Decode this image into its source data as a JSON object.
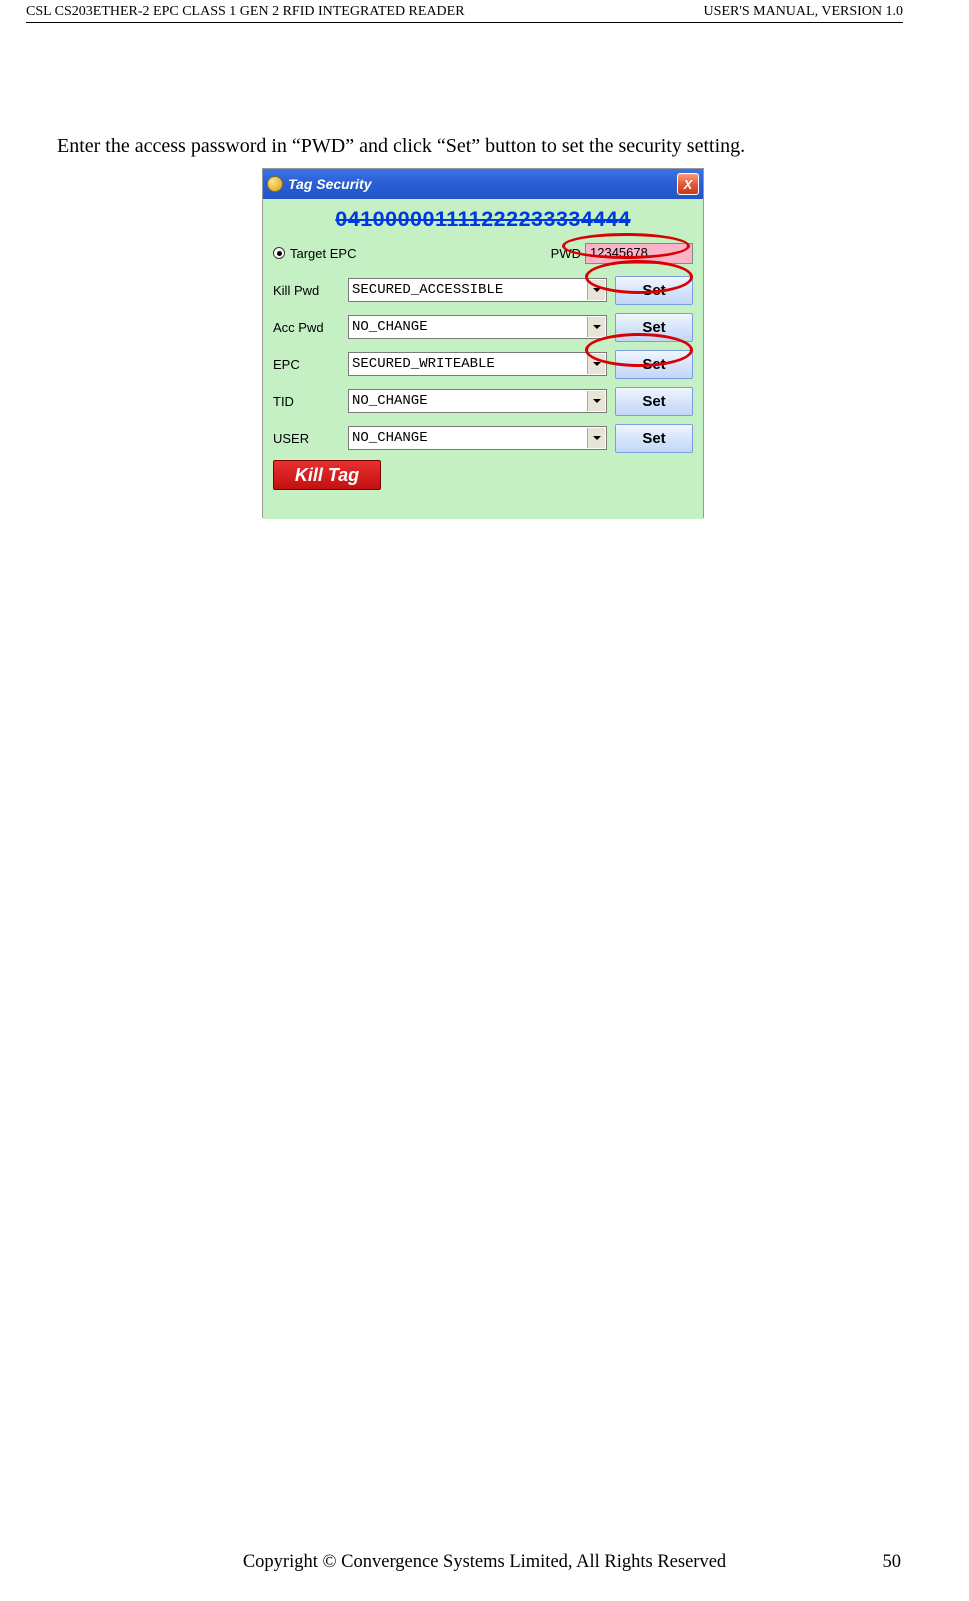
{
  "header": {
    "left": "CSL CS203ETHER-2 EPC CLASS 1 GEN 2 RFID INTEGRATED READER",
    "right": "USER'S  MANUAL,  VERSION  1.0"
  },
  "instruction": "Enter the access password in “PWD” and click “Set” button to set the security setting.",
  "window": {
    "title": "Tag Security",
    "close": "X",
    "epc": "041000001111222233334444",
    "target_label": "Target EPC",
    "pwd_label": "PWD",
    "pwd_value": "12345678",
    "rows": {
      "killpwd": {
        "label": "Kill Pwd",
        "value": "SECURED_ACCESSIBLE",
        "btn": "Set"
      },
      "accpwd": {
        "label": "Acc Pwd",
        "value": "NO_CHANGE",
        "btn": "Set"
      },
      "epc": {
        "label": "EPC",
        "value": "SECURED_WRITEABLE",
        "btn": "Set"
      },
      "tid": {
        "label": "TID",
        "value": "NO_CHANGE",
        "btn": "Set"
      },
      "user": {
        "label": "USER",
        "value": "NO_CHANGE",
        "btn": "Set"
      }
    },
    "kill_btn": "Kill Tag"
  },
  "footer": {
    "copyright": "Copyright © Convergence Systems Limited, All Rights Reserved",
    "page": "50"
  }
}
